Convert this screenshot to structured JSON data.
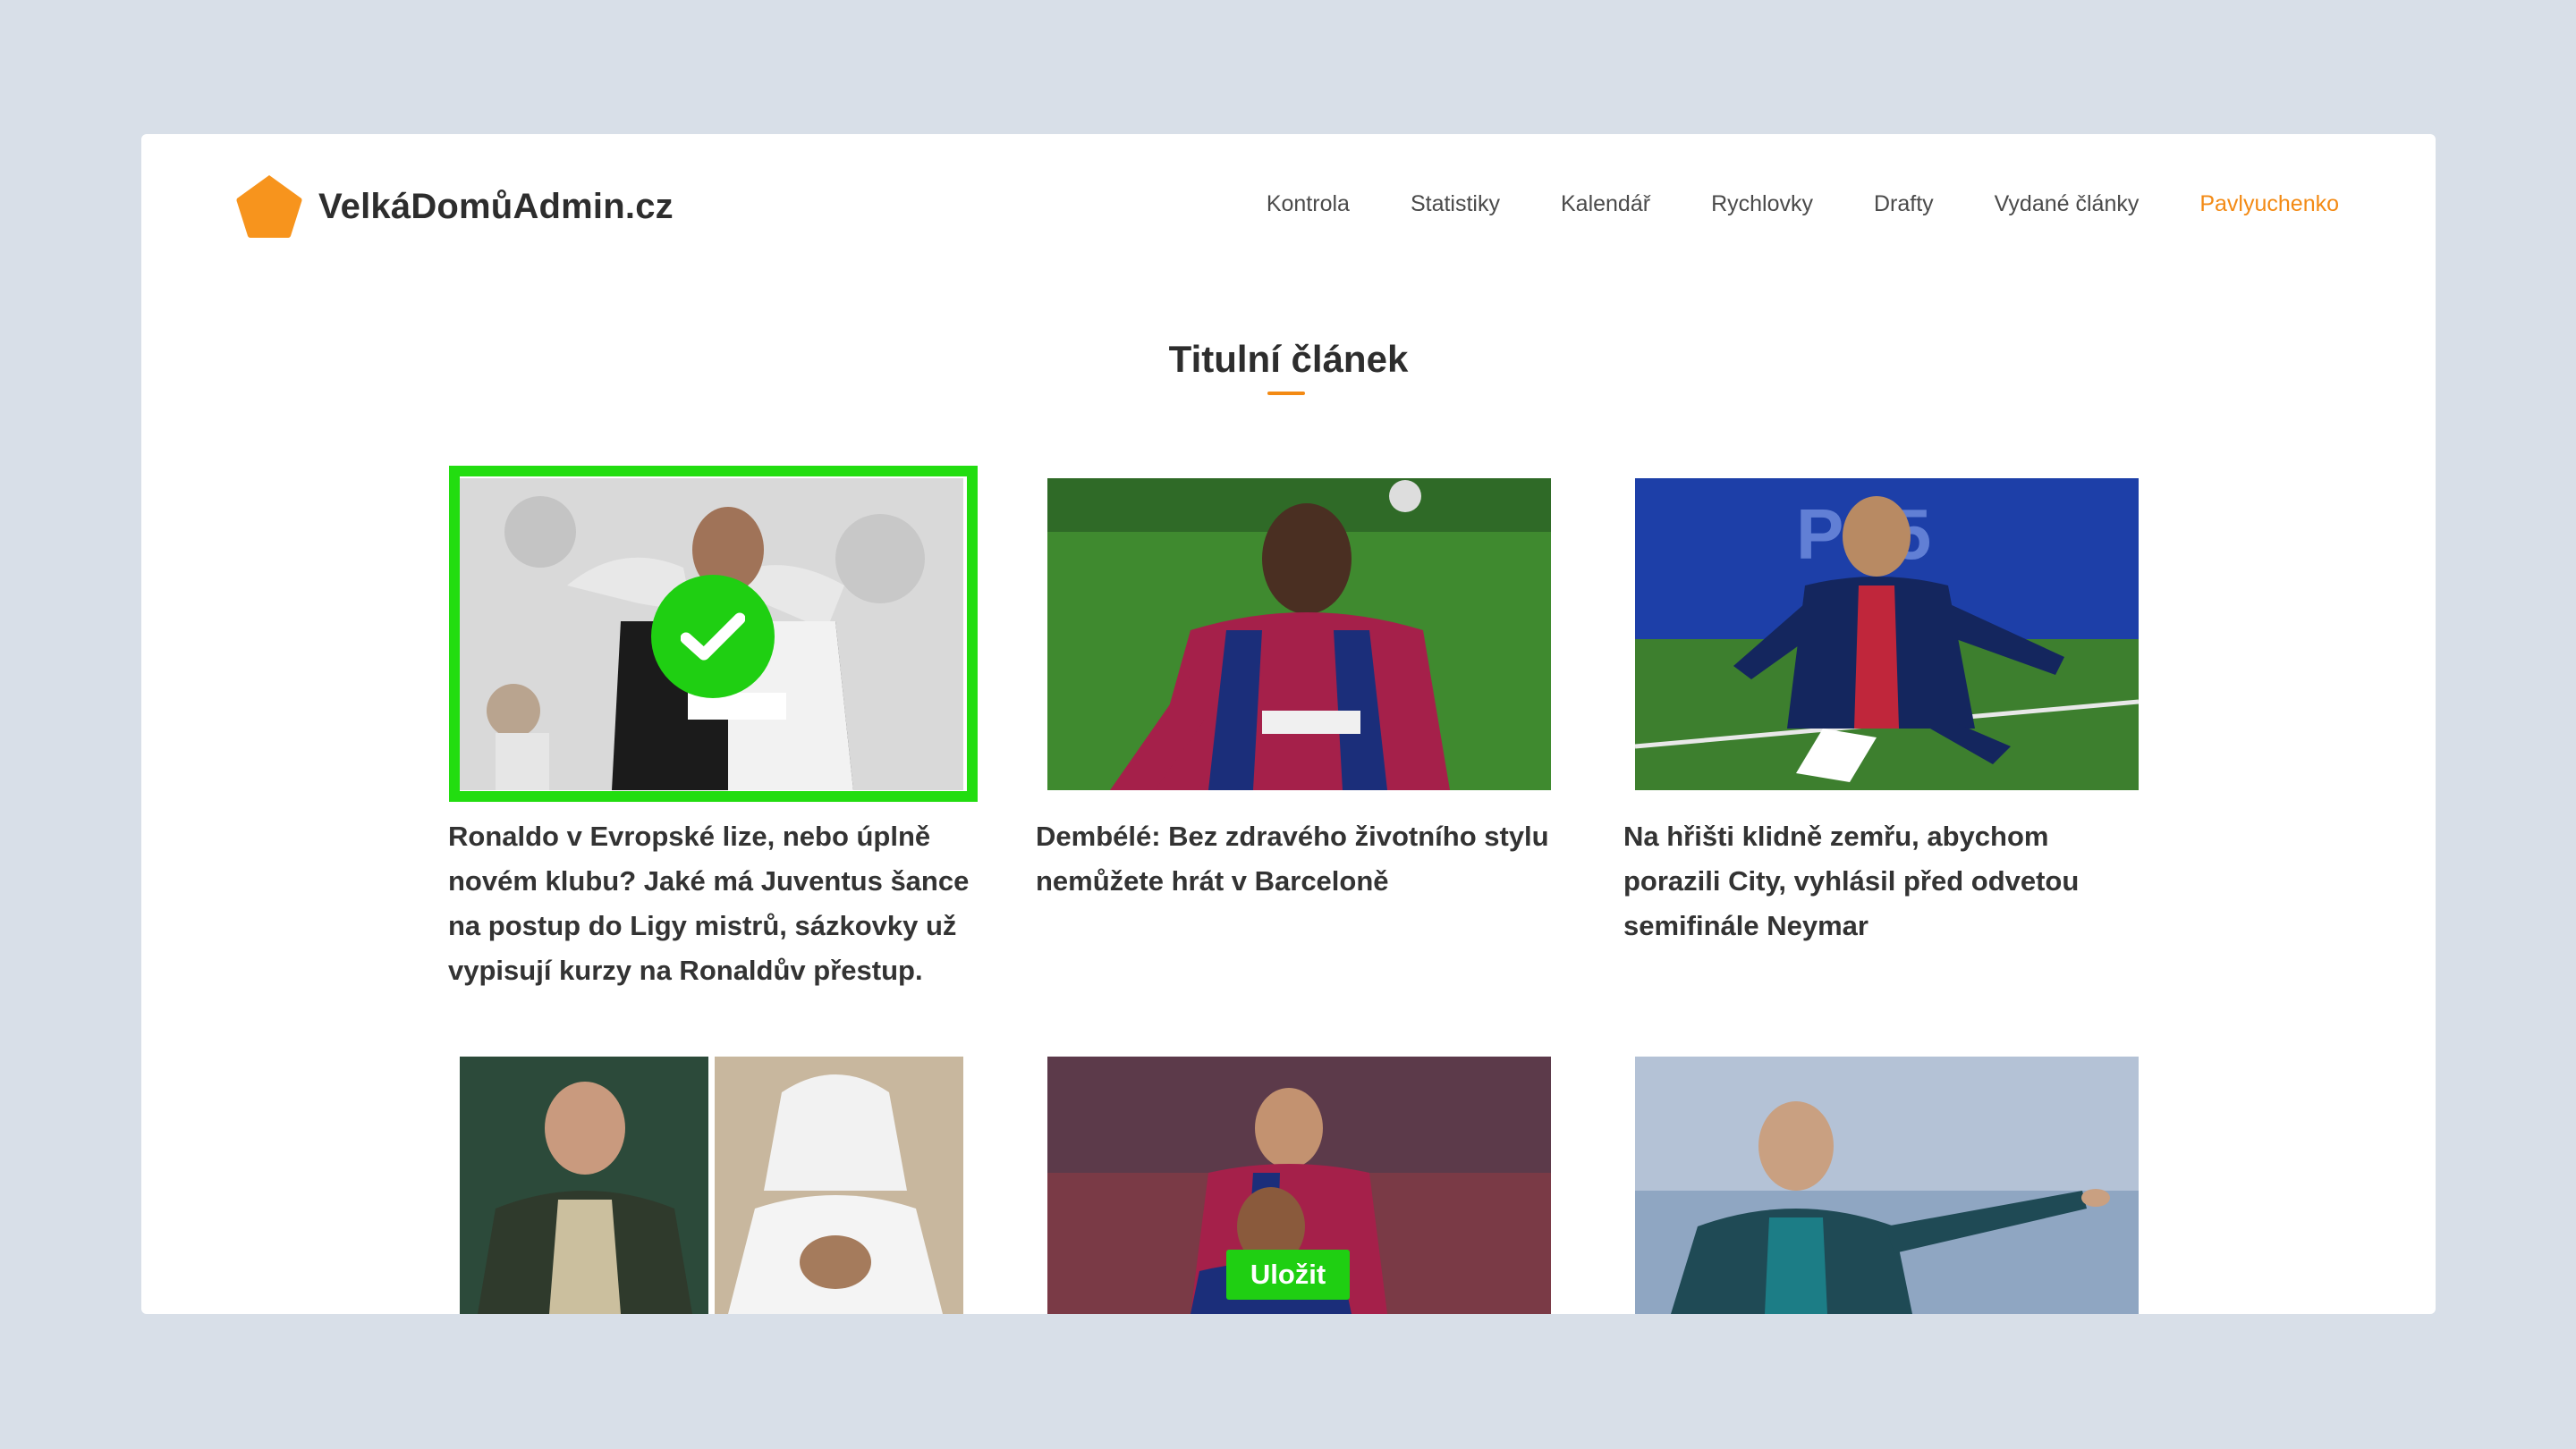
{
  "app": {
    "logo_text": "VelkáDomůAdmin.cz",
    "accent_color": "#f38a14",
    "selected_color": "#22dd10"
  },
  "nav": {
    "items": [
      {
        "label": "Kontrola",
        "active": false
      },
      {
        "label": "Statistiky",
        "active": false
      },
      {
        "label": "Kalendář",
        "active": false
      },
      {
        "label": "Rychlovky",
        "active": false
      },
      {
        "label": "Drafty",
        "active": false
      },
      {
        "label": "Vydané články",
        "active": false
      },
      {
        "label": "Pavlyuchenko",
        "active": true
      }
    ]
  },
  "section": {
    "title": "Titulní článek"
  },
  "articles": [
    {
      "title": "Ronaldo v Evropské lize, nebo úplně novém klubu? Jaké má Juventus šance na postup do Ligy mistrů, sázkovky už vypisují kurzy na Ronaldův přestup.",
      "selected": true,
      "image": "ronaldo-juventus-photo"
    },
    {
      "title": "Dembélé: Bez zdravého životního stylu nemůžete hrát v Barceloně",
      "selected": false,
      "image": "dembele-barcelona-photo"
    },
    {
      "title": "Na hřišti klidně zemřu, abychom porazili City, vyhlásil před odvetou semifinále Neymar",
      "selected": false,
      "image": "neymar-psg-photo"
    },
    {
      "title": "",
      "selected": false,
      "image": "club-owners-photo"
    },
    {
      "title": "",
      "selected": false,
      "image": "messi-alves-photo"
    },
    {
      "title": "",
      "selected": false,
      "image": "coach-sideline-photo"
    }
  ],
  "actions": {
    "save_label": "Uložit",
    "add_icon": "plus-icon",
    "check_icon": "checkmark-icon"
  }
}
